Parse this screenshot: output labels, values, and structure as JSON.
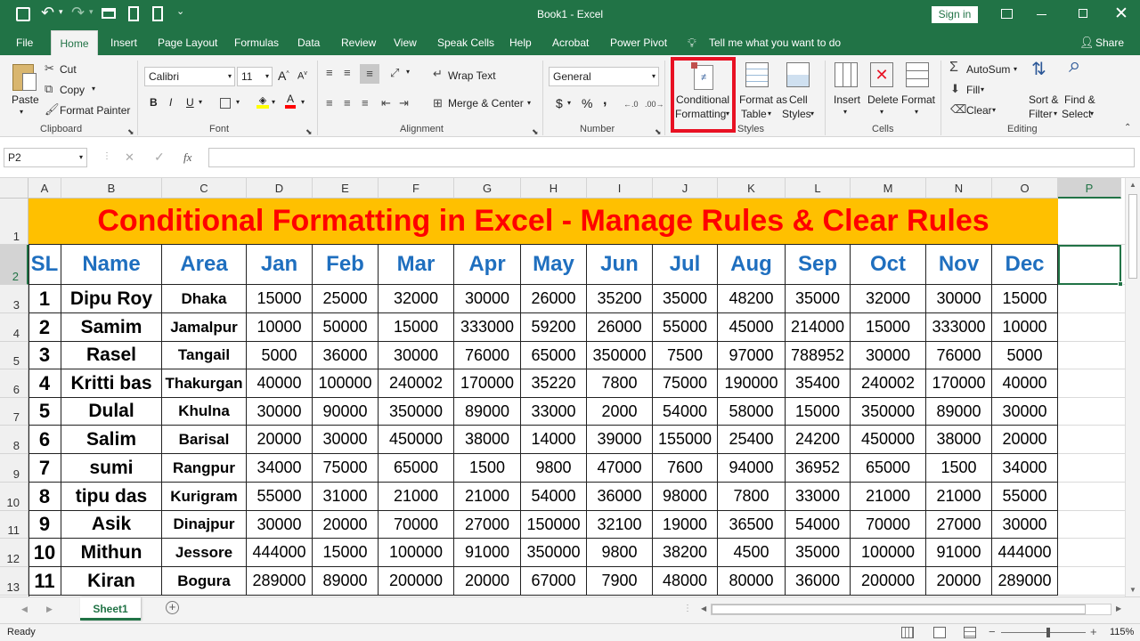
{
  "titlebar": {
    "title": "Book1 - Excel",
    "signin": "Sign in"
  },
  "tabs": [
    "File",
    "Home",
    "Insert",
    "Page Layout",
    "Formulas",
    "Data",
    "Review",
    "View",
    "Speak Cells",
    "Help",
    "Acrobat",
    "Power Pivot"
  ],
  "tell_me": "Tell me what you want to do",
  "share": "Share",
  "clipboard": {
    "paste": "Paste",
    "cut": "Cut",
    "copy": "Copy",
    "format_painter": "Format Painter",
    "group": "Clipboard"
  },
  "font": {
    "name": "Calibri",
    "size": "11",
    "group": "Font",
    "bold": "B",
    "italic": "I",
    "underline": "U"
  },
  "alignment": {
    "wrap": "Wrap Text",
    "merge": "Merge & Center",
    "group": "Alignment"
  },
  "number": {
    "format": "General",
    "currency": "$",
    "percent": "%",
    "comma": ",",
    "group": "Number"
  },
  "styles": {
    "cond_line1": "Conditional",
    "cond_line2": "Formatting",
    "fmt_table_line1": "Format as",
    "fmt_table_line2": "Table",
    "cell_styles_line1": "Cell",
    "cell_styles_line2": "Styles",
    "group": "Styles"
  },
  "cells": {
    "insert": "Insert",
    "delete": "Delete",
    "format": "Format",
    "group": "Cells"
  },
  "editing": {
    "autosum": "AutoSum",
    "fill": "Fill",
    "clear": "Clear",
    "sort_line1": "Sort &",
    "sort_line2": "Filter",
    "find_line1": "Find &",
    "find_line2": "Select",
    "group": "Editing"
  },
  "formula_bar": {
    "name_box": "P2",
    "fx": "fx",
    "value": ""
  },
  "grid": {
    "columns": [
      "A",
      "B",
      "C",
      "D",
      "E",
      "F",
      "G",
      "H",
      "I",
      "J",
      "K",
      "L",
      "M",
      "N",
      "O",
      "P"
    ],
    "rows": [
      "1",
      "2",
      "3",
      "4",
      "5",
      "6",
      "7",
      "8",
      "9",
      "10",
      "11",
      "12",
      "13"
    ],
    "banner": "Conditional Formatting in Excel - Manage Rules & Clear Rules",
    "headers": [
      "SL",
      "Name",
      "Area",
      "Jan",
      "Feb",
      "Mar",
      "Apr",
      "May",
      "Jun",
      "Jul",
      "Aug",
      "Sep",
      "Oct",
      "Nov",
      "Dec"
    ],
    "data": [
      [
        "1",
        "Dipu Roy",
        "Dhaka",
        "15000",
        "25000",
        "32000",
        "30000",
        "26000",
        "35200",
        "35000",
        "48200",
        "35000",
        "32000",
        "30000",
        "15000"
      ],
      [
        "2",
        "Samim",
        "Jamalpur",
        "10000",
        "50000",
        "15000",
        "333000",
        "59200",
        "26000",
        "55000",
        "45000",
        "214000",
        "15000",
        "333000",
        "10000"
      ],
      [
        "3",
        "Rasel",
        "Tangail",
        "5000",
        "36000",
        "30000",
        "76000",
        "65000",
        "350000",
        "7500",
        "97000",
        "788952",
        "30000",
        "76000",
        "5000"
      ],
      [
        "4",
        "Kritti bas",
        "Thakurgan",
        "40000",
        "100000",
        "240002",
        "170000",
        "35220",
        "7800",
        "75000",
        "190000",
        "35400",
        "240002",
        "170000",
        "40000"
      ],
      [
        "5",
        "Dulal",
        "Khulna",
        "30000",
        "90000",
        "350000",
        "89000",
        "33000",
        "2000",
        "54000",
        "58000",
        "15000",
        "350000",
        "89000",
        "30000"
      ],
      [
        "6",
        "Salim",
        "Barisal",
        "20000",
        "30000",
        "450000",
        "38000",
        "14000",
        "39000",
        "155000",
        "25400",
        "24200",
        "450000",
        "38000",
        "20000"
      ],
      [
        "7",
        "sumi",
        "Rangpur",
        "34000",
        "75000",
        "65000",
        "1500",
        "9800",
        "47000",
        "7600",
        "94000",
        "36952",
        "65000",
        "1500",
        "34000"
      ],
      [
        "8",
        "tipu das",
        "Kurigram",
        "55000",
        "31000",
        "21000",
        "21000",
        "54000",
        "36000",
        "98000",
        "7800",
        "33000",
        "21000",
        "21000",
        "55000"
      ],
      [
        "9",
        "Asik",
        "Dinajpur",
        "30000",
        "20000",
        "70000",
        "27000",
        "150000",
        "32100",
        "19000",
        "36500",
        "54000",
        "70000",
        "27000",
        "30000"
      ],
      [
        "10",
        "Mithun",
        "Jessore",
        "444000",
        "15000",
        "100000",
        "91000",
        "350000",
        "9800",
        "38200",
        "4500",
        "35000",
        "100000",
        "91000",
        "444000"
      ],
      [
        "11",
        "Kiran",
        "Bogura",
        "289000",
        "89000",
        "200000",
        "20000",
        "67000",
        "7900",
        "48000",
        "80000",
        "36000",
        "200000",
        "20000",
        "289000"
      ]
    ]
  },
  "sheet_tab": "Sheet1",
  "status": {
    "ready": "Ready",
    "zoom": "115%"
  },
  "colors": {
    "brand": "#217346",
    "banner_bg": "#ffc000",
    "banner_text": "#ff0000",
    "header_text": "#1f6fbf",
    "highlight": "#e81123"
  }
}
